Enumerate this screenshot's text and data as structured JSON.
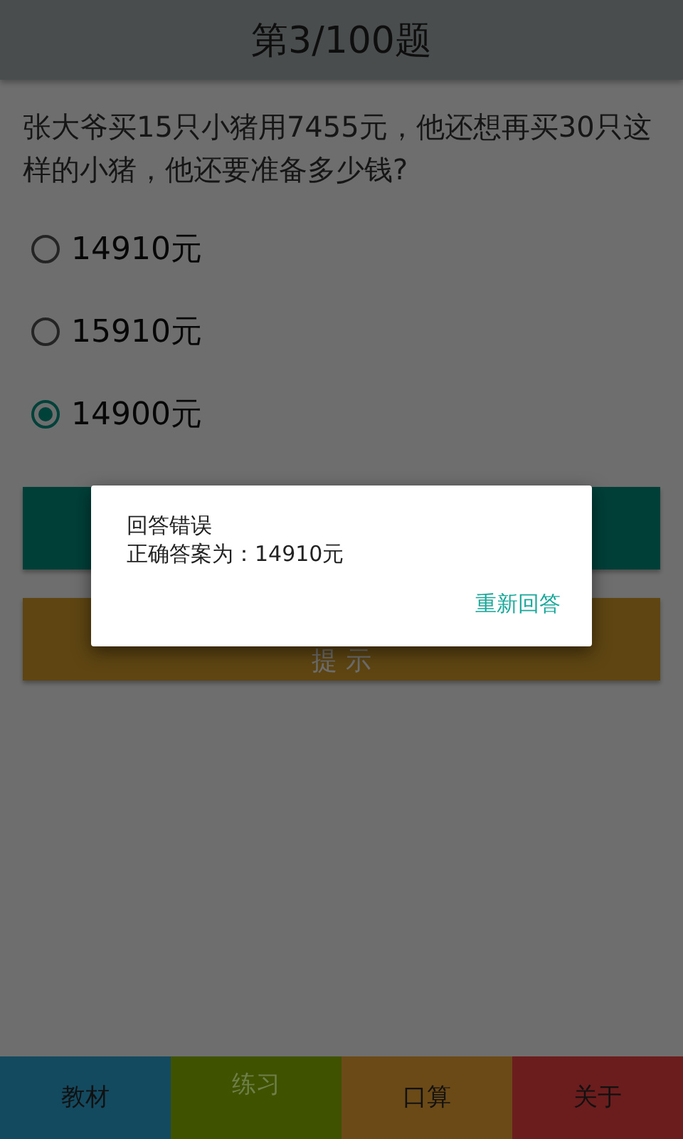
{
  "header": {
    "title": "第3/100题"
  },
  "question": "张大爷买15只小猪用7455元，他还想再买30只这样的小猪，他还要准备多少钱?",
  "options": [
    {
      "label": "14910元",
      "selected": false
    },
    {
      "label": "15910元",
      "selected": false
    },
    {
      "label": "14900元",
      "selected": true
    }
  ],
  "buttons": [
    {
      "kind": "submit"
    },
    {
      "kind": "hint",
      "label": "提 示"
    }
  ],
  "dialog": {
    "title": "回答错误",
    "message": "正确答案为：14910元",
    "action": "重新回答"
  },
  "bottom_nav": [
    {
      "label": "教材",
      "selected": false,
      "color": "#134a60"
    },
    {
      "label": "练习",
      "selected": true,
      "color": "#3f5200"
    },
    {
      "label": "口算",
      "selected": false,
      "color": "#6b4a18"
    },
    {
      "label": "关于",
      "selected": false,
      "color": "#6b1c1c"
    }
  ]
}
